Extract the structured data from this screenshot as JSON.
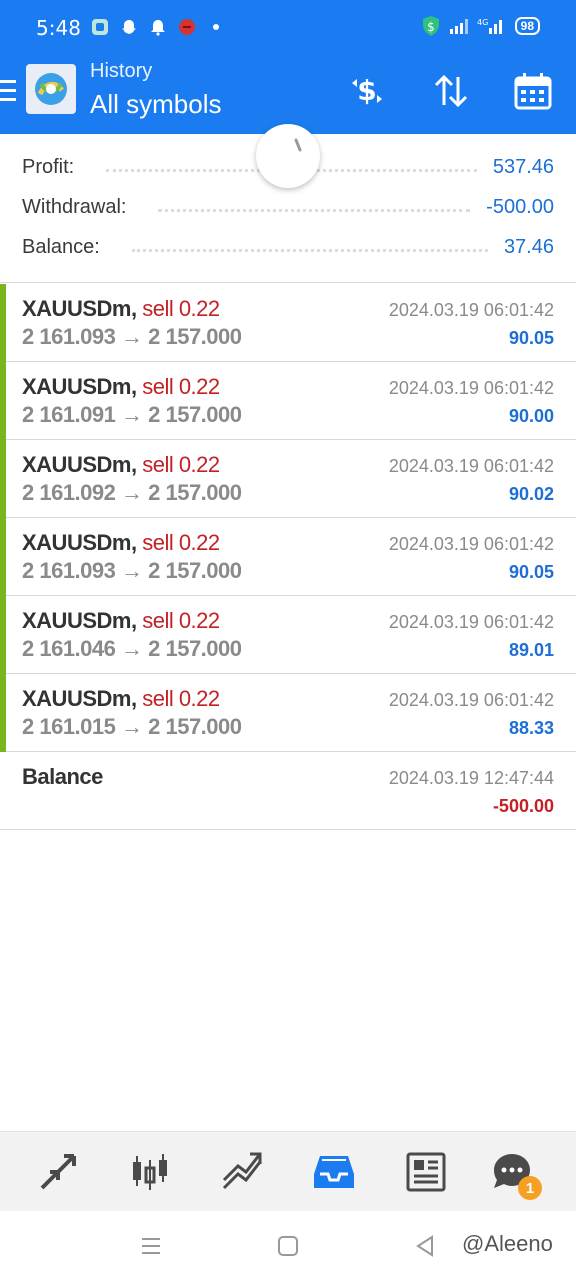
{
  "status_bar": {
    "time": "5:48",
    "battery": "98",
    "network": "4G"
  },
  "app_bar": {
    "title": "History",
    "subtitle": "All symbols"
  },
  "summary": {
    "profit_label": "Profit:",
    "profit_value": "537.46",
    "withdrawal_label": "Withdrawal:",
    "withdrawal_value": "-500.00",
    "balance_label": "Balance:",
    "balance_value": "37.46"
  },
  "trades": [
    {
      "symbol": "XAUUSDm,",
      "side": "sell 0.22",
      "open_price": "2 161.093",
      "arrow": "→",
      "close_price": "2 157.000",
      "time": "2024.03.19 06:01:42",
      "profit": "90.05"
    },
    {
      "symbol": "XAUUSDm,",
      "side": "sell 0.22",
      "open_price": "2 161.091",
      "arrow": "→",
      "close_price": "2 157.000",
      "time": "2024.03.19 06:01:42",
      "profit": "90.00"
    },
    {
      "symbol": "XAUUSDm,",
      "side": "sell 0.22",
      "open_price": "2 161.092",
      "arrow": "→",
      "close_price": "2 157.000",
      "time": "2024.03.19 06:01:42",
      "profit": "90.02"
    },
    {
      "symbol": "XAUUSDm,",
      "side": "sell 0.22",
      "open_price": "2 161.093",
      "arrow": "→",
      "close_price": "2 157.000",
      "time": "2024.03.19 06:01:42",
      "profit": "90.05"
    },
    {
      "symbol": "XAUUSDm,",
      "side": "sell 0.22",
      "open_price": "2 161.046",
      "arrow": "→",
      "close_price": "2 157.000",
      "time": "2024.03.19 06:01:42",
      "profit": "89.01"
    },
    {
      "symbol": "XAUUSDm,",
      "side": "sell 0.22",
      "open_price": "2 161.015",
      "arrow": "→",
      "close_price": "2 157.000",
      "time": "2024.03.19 06:01:42",
      "profit": "88.33"
    }
  ],
  "balance_entry": {
    "label": "Balance",
    "time": "2024.03.19 12:47:44",
    "amount": "-500.00"
  },
  "bottom_nav": {
    "items": [
      "quotes-icon",
      "chart-icon",
      "trade-icon",
      "history-icon",
      "news-icon",
      "chat-icon"
    ],
    "active": "history-icon",
    "chat_badge": "1"
  },
  "watermark": "@Aleeno",
  "colors": {
    "primary": "#1a7cf0",
    "profit_blue": "#1d6fd6",
    "sell_red": "#c42127",
    "trade_marker_green": "#7ab51d",
    "badge_orange": "#f5a022"
  }
}
